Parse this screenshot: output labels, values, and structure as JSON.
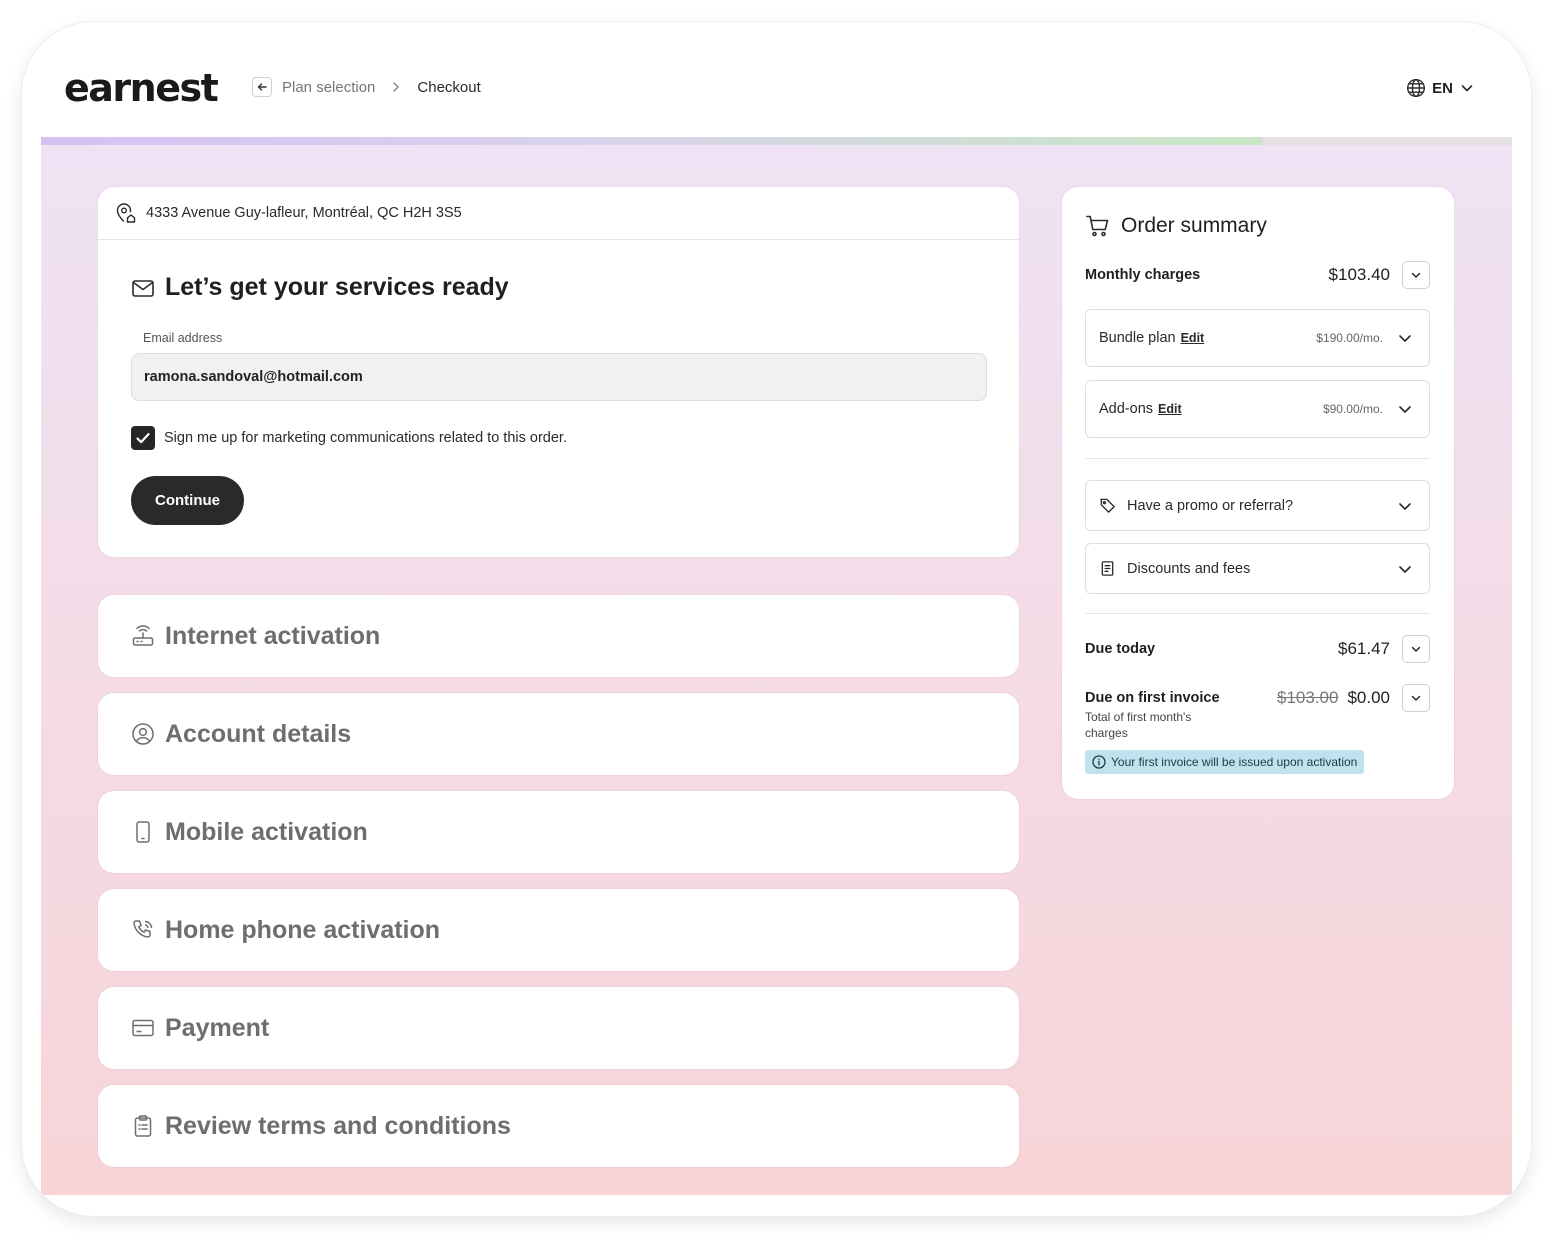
{
  "brand": {
    "logo_text": "earnest"
  },
  "breadcrumb": {
    "previous": "Plan selection",
    "current": "Checkout"
  },
  "language": {
    "label": "EN"
  },
  "progress": {
    "percent": 83
  },
  "address": {
    "text": "4333 Avenue Guy-lafleur, Montréal, QC H2H 3S5"
  },
  "email_section": {
    "title": "Let’s get your services ready",
    "email_label": "Email address",
    "email_value": "ramona.sandoval@hotmail.com",
    "marketing_consent_label": "Sign me up for marketing communications related to this order.",
    "marketing_consent_checked": true,
    "continue_label": "Continue"
  },
  "steps": [
    {
      "title": "Internet activation",
      "icon": "router-icon"
    },
    {
      "title": "Account details",
      "icon": "user-circle-icon"
    },
    {
      "title": "Mobile activation",
      "icon": "mobile-icon"
    },
    {
      "title": "Home phone activation",
      "icon": "phone-icon"
    },
    {
      "title": "Payment",
      "icon": "credit-card-icon"
    },
    {
      "title": "Review terms and conditions",
      "icon": "clipboard-icon"
    }
  ],
  "order_summary": {
    "title": "Order summary",
    "monthly_charges": {
      "label": "Monthly charges",
      "amount": "$103.40"
    },
    "bundle_plan": {
      "label": "Bundle plan",
      "edit": "Edit",
      "price": "$190.00/mo."
    },
    "add_ons": {
      "label": "Add-ons",
      "edit": "Edit",
      "price": "$90.00/mo."
    },
    "promo": {
      "label": "Have a promo or referral?"
    },
    "discounts": {
      "label": "Discounts and fees"
    },
    "due_today": {
      "label": "Due today",
      "amount": "$61.47"
    },
    "due_first_invoice": {
      "label": "Due on first invoice",
      "original": "$103.00",
      "amount": "$0.00",
      "note": "Total of first month's charges"
    },
    "info_badge": "Your first invoice will be issued upon activation"
  },
  "colors": {
    "primary_dark": "#2a2a2a",
    "background_top": "#efe2f4",
    "background_bottom": "#f8d4d8",
    "info_badge": "#bfe3ee"
  }
}
